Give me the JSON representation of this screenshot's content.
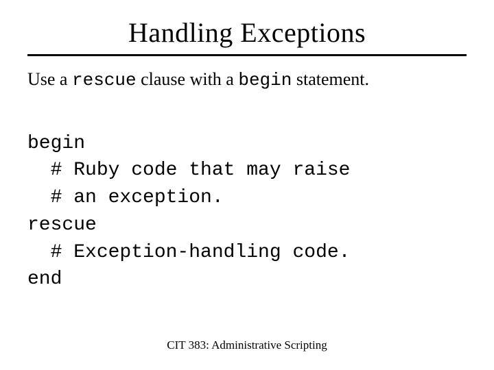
{
  "title": "Handling Exceptions",
  "intro": {
    "part1": "Use a ",
    "code1": "rescue",
    "part2": " clause with a ",
    "code2": "begin",
    "part3": " statement."
  },
  "code": {
    "l1": "begin",
    "l2": "  # Ruby code that may raise",
    "l3": "  # an exception.",
    "l4": "rescue",
    "l5": "  # Exception-handling code.",
    "l6": "end"
  },
  "footer": "CIT 383: Administrative Scripting"
}
